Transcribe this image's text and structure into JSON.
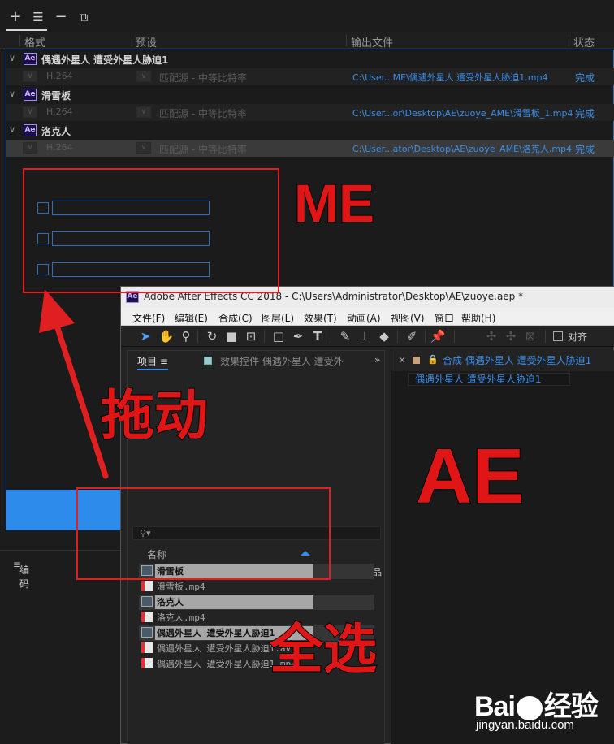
{
  "media_encoder": {
    "columns": {
      "format": "格式",
      "preset": "预设",
      "output": "输出文件",
      "status": "状态"
    },
    "groups": [
      {
        "title": "偶遇外星人 遭受外星人胁迫1",
        "format": "H.264",
        "preset": "匹配源 - 中等比特率",
        "output": "C:\\User...ME\\偶遇外星人 遭受外星人胁迫1.mp4",
        "status": "完成"
      },
      {
        "title": "滑雪板",
        "format": "H.264",
        "preset": "匹配源 - 中等比特率",
        "output": "C:\\User...or\\Desktop\\AE\\zuoye_AME\\滑雪板_1.mp4",
        "status": "完成"
      },
      {
        "title": "洛克人",
        "format": "H.264",
        "preset": "匹配源 - 中等比特率",
        "output": "C:\\User...ator\\Desktop\\AE\\zuoye_AME\\洛克人.mp4",
        "status": "完成"
      }
    ],
    "encode_panel": "编码",
    "badge_text": "Ae"
  },
  "after_effects": {
    "title": "Adobe After Effects CC 2018 - C:\\Users\\Administrator\\Desktop\\AE\\zuoye.aep *",
    "menu": [
      "文件(F)",
      "编辑(E)",
      "合成(C)",
      "图层(L)",
      "效果(T)",
      "动画(A)",
      "视图(V)",
      "窗口",
      "帮助(H)"
    ],
    "align_label": "对齐",
    "project_tab": "项目",
    "effects_tab": "效果控件 偶遇外星人 遭受外",
    "comp_tab": "合成 偶遇外星人 遭受外星人胁迫1",
    "comp_crumb": "偶遇外星人 遭受外星人胁迫1",
    "search_glyph": "⚲▾",
    "name_header": "名称",
    "items": [
      {
        "type": "comp",
        "name": "滑雪板"
      },
      {
        "type": "file",
        "name": "滑雪板.mp4"
      },
      {
        "type": "comp",
        "name": "洛克人"
      },
      {
        "type": "file",
        "name": "洛克人.mp4"
      },
      {
        "type": "comp",
        "name": "偶遇外星人 遭受外星人胁迫1"
      },
      {
        "type": "file",
        "name": "偶遇外星人 遭受外星人胁迫1.avi"
      },
      {
        "type": "file",
        "name": "偶遇外星人 遭受外星人胁迫1.mp4"
      }
    ]
  },
  "annotations": {
    "me": "ME",
    "ae": "AE",
    "drag": "拖动",
    "select_all": "全选"
  },
  "watermark": {
    "logo_left": "Bai",
    "logo_right": "经验",
    "url": "jingyan.baidu.com"
  },
  "colors": {
    "accent_blue": "#3c8ce7",
    "annotation_red": "#e01515"
  }
}
